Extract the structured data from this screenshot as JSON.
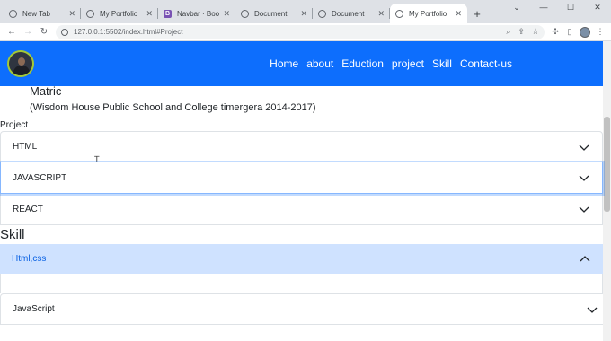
{
  "browser": {
    "tabs": [
      {
        "title": "New Tab",
        "icon": "chrome-icon"
      },
      {
        "title": "My Portfolio",
        "icon": "globe-icon"
      },
      {
        "title": "Navbar · Bootstrap",
        "icon": "bootstrap-icon"
      },
      {
        "title": "Document",
        "icon": "globe-icon"
      },
      {
        "title": "Document",
        "icon": "globe-icon"
      },
      {
        "title": "My Portfolio",
        "icon": "globe-icon"
      }
    ],
    "bootstrap_glyph": "B",
    "url": "127.0.0.1:5502/index.html#Project"
  },
  "navbar": {
    "links": [
      "Home",
      "about",
      "Eduction",
      "project",
      "Skill",
      "Contact-us"
    ]
  },
  "education": {
    "degree": "Matric",
    "school": "(Wisdom House Public School and College timergera 2014-2017)"
  },
  "project": {
    "heading": "Project",
    "items": [
      "HTML",
      "JAVASCRIPT",
      "REACT"
    ]
  },
  "skill": {
    "heading": "Skill",
    "open_item": "Html,css",
    "items": [
      "JavaScript"
    ]
  },
  "colors": {
    "navbar": "#0d6efd",
    "accordion_open_bg": "#cfe2ff",
    "accordion_open_text": "#0c63e4"
  }
}
